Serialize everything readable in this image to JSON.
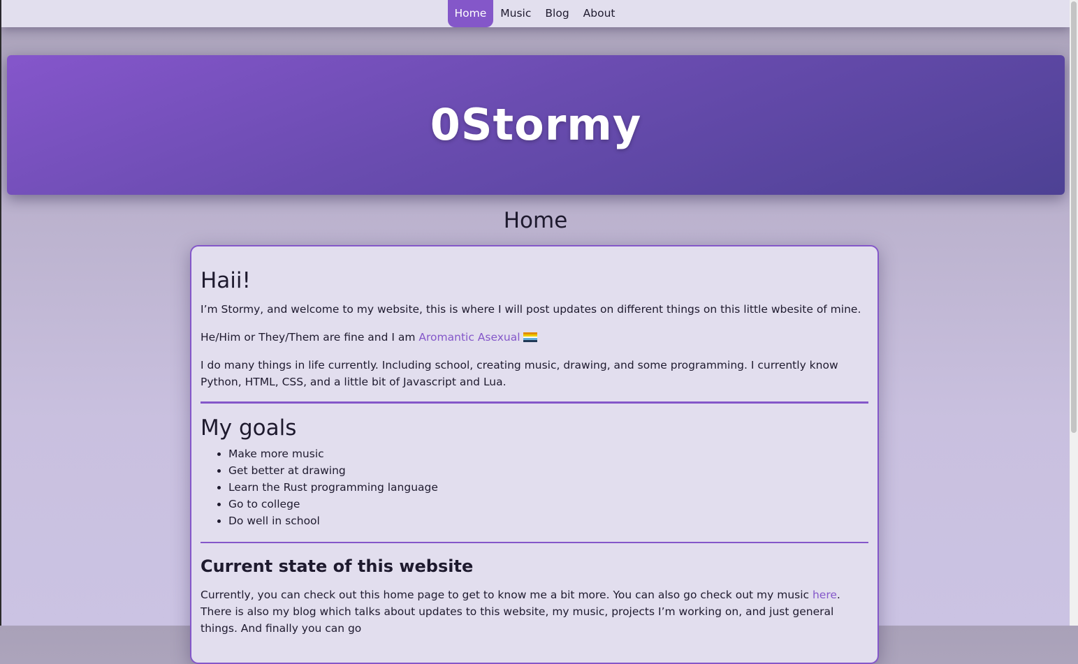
{
  "nav": {
    "items": [
      {
        "label": "Home",
        "active": true
      },
      {
        "label": "Music",
        "active": false
      },
      {
        "label": "Blog",
        "active": false
      },
      {
        "label": "About",
        "active": false
      }
    ]
  },
  "banner": {
    "title": "0Stormy"
  },
  "page": {
    "heading": "Home"
  },
  "content": {
    "intro_heading": "Haii!",
    "intro_p1": "I’m Stormy, and welcome to my website, this is where I will post updates on different things on this little wbesite of mine.",
    "intro_p2_prefix": "He/Him or They/Them are fine and I am ",
    "intro_p2_link": "Aromantic Asexual",
    "intro_p3": "I do many things in life currently. Including school, creating music, drawing, and some programming. I currently know Python, HTML, CSS, and a little bit of Javascript and Lua.",
    "goals_heading": "My goals",
    "goals": [
      "Make more music",
      "Get better at drawing",
      "Learn the Rust programming language",
      "Go to college",
      "Do well in school"
    ],
    "state_heading": "Current state of this website",
    "state_p_prefix": "Currently, you can check out this home page to get to know me a bit more. You can also go check out my music ",
    "state_p_link": "here",
    "state_p_suffix": ". There is also my blog which talks about updates to this website, my music, projects I’m working on, and just general things. And finally you can go"
  },
  "colors": {
    "accent": "#8457c9",
    "card_bg": "#e2deee",
    "nav_bg": "#e2dfee"
  },
  "flag_colors": [
    "#e28c00",
    "#eccd00",
    "#ffffff",
    "#62aedc",
    "#203856"
  ]
}
